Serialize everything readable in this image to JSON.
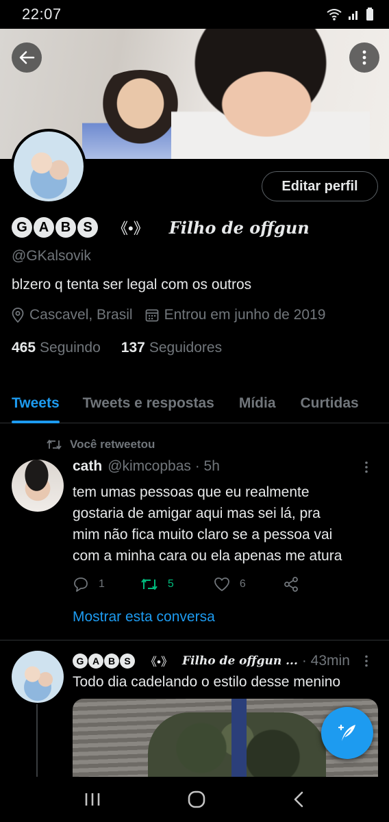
{
  "status_bar": {
    "time": "22:07"
  },
  "profile": {
    "edit_label": "Editar perfil",
    "name_letters": [
      "G",
      "A",
      "B",
      "S"
    ],
    "name_symbol": "《•》",
    "name_script": "Filho de offgun",
    "handle": "@GKalsovik",
    "bio": "blzero q tenta ser legal com os outros",
    "location": "Cascavel, Brasil",
    "joined": "Entrou em junho de 2019",
    "following_count": "465",
    "following_label": "Seguindo",
    "followers_count": "137",
    "followers_label": "Seguidores"
  },
  "tabs": [
    {
      "label": "Tweets"
    },
    {
      "label": "Tweets e respostas"
    },
    {
      "label": "Mídia"
    },
    {
      "label": "Curtidas"
    }
  ],
  "tweet1": {
    "retweet_label": "Você retweetou",
    "name": "cath",
    "handle": "@kimcopbas · 5h",
    "lines": [
      "tem umas pessoas que eu realmente",
      "gostaria de amigar aqui mas sei lá, pra",
      "mim não fica muito claro se a pessoa vai",
      "com a minha cara ou ela apenas me atura"
    ],
    "replies": "1",
    "retweets": "5",
    "likes": "6",
    "show_conversation": "Mostrar esta conversa"
  },
  "tweet2": {
    "name_letters": [
      "G",
      "A",
      "B",
      "S"
    ],
    "name_symbol": "《•》",
    "name_script": "Filho de offgun ...",
    "time": "· 43min",
    "text": "Todo dia cadelando o estilo desse menino"
  },
  "colors": {
    "accent": "#1d9bf0",
    "retweet_green": "#00ba7c",
    "muted": "#71767b",
    "background": "#000000"
  },
  "icons": [
    "back-arrow-icon",
    "more-vertical-icon",
    "location-pin-icon",
    "calendar-icon",
    "retweet-icon",
    "reply-icon",
    "like-icon",
    "share-icon",
    "compose-icon",
    "wifi-icon",
    "signal-icon",
    "battery-icon"
  ]
}
